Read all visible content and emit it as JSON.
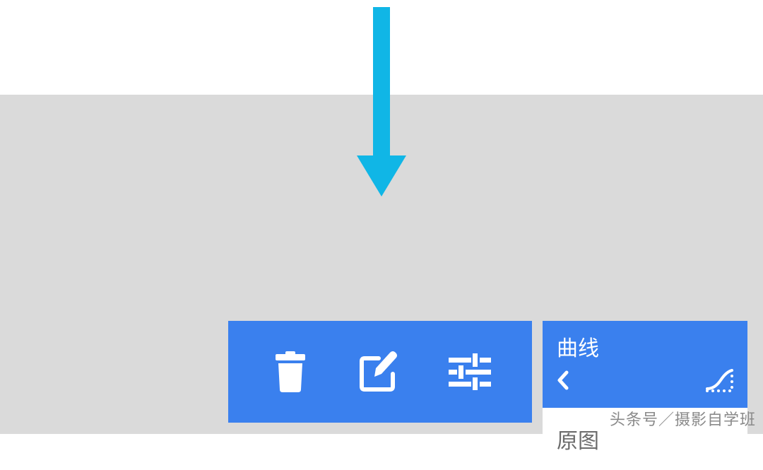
{
  "toolbar": {
    "icons": {
      "delete": "trash-icon",
      "edit": "edit-brush-icon",
      "tune": "tune-icon"
    }
  },
  "panel": {
    "curves_title": "曲线",
    "original_label": "原图"
  },
  "watermark": "头条号／摄影自学班"
}
